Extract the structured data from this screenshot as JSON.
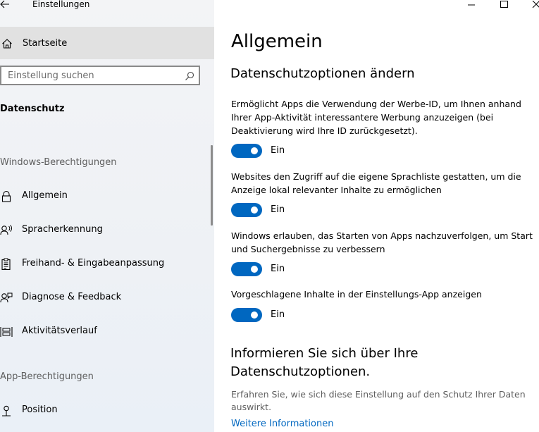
{
  "window": {
    "title": "Einstellungen",
    "controls": [
      "minimize-icon",
      "maximize-icon",
      "close-icon"
    ]
  },
  "sidebar": {
    "home_label": "Startseite",
    "search": {
      "value": "",
      "placeholder": "Einstellung suchen"
    },
    "category_title": "Datenschutz",
    "sections": [
      {
        "heading": "Windows-Berechtigungen",
        "items": [
          {
            "label": "Allgemein",
            "icon": "lock-icon"
          },
          {
            "label": "Spracherkennung",
            "icon": "speech-icon"
          },
          {
            "label": "Freihand- & Eingabeanpassung",
            "icon": "clipboard-icon"
          },
          {
            "label": "Diagnose & Feedback",
            "icon": "feedback-icon"
          },
          {
            "label": "Aktivitätsverlauf",
            "icon": "timeline-icon"
          }
        ]
      },
      {
        "heading": "App-Berechtigungen",
        "items": [
          {
            "label": "Position",
            "icon": "location-icon"
          }
        ]
      }
    ]
  },
  "main": {
    "title": "Allgemein",
    "subtitle": "Datenschutzoptionen ändern",
    "settings": [
      {
        "description": "Ermöglicht Apps die Verwendung der Werbe-ID, um Ihnen anhand Ihrer App-Aktivität interessantere Werbung anzuzeigen (bei Deaktivierung wird Ihre ID zurückgesetzt).",
        "state": "Ein"
      },
      {
        "description": "Websites den Zugriff auf die eigene Sprachliste gestatten, um die Anzeige lokal relevanter Inhalte zu ermöglichen",
        "state": "Ein"
      },
      {
        "description": "Windows erlauben, das Starten von Apps nachzuverfolgen, um Start und Suchergebnisse zu verbessern",
        "state": "Ein"
      },
      {
        "description": "Vorgeschlagene Inhalte in der Einstellungs-App anzeigen",
        "state": "Ein"
      }
    ],
    "info": {
      "heading": "Informieren Sie sich über Ihre Datenschutzoptionen.",
      "description": "Erfahren Sie, wie sich diese Einstellung auf den Schutz Ihrer Daten auswirkt.",
      "link": "Weitere Informationen"
    }
  },
  "colors": {
    "accent": "#0067c0",
    "sidebar_bg": "#f3f4f6",
    "selected_bg": "#e1e1e1"
  }
}
